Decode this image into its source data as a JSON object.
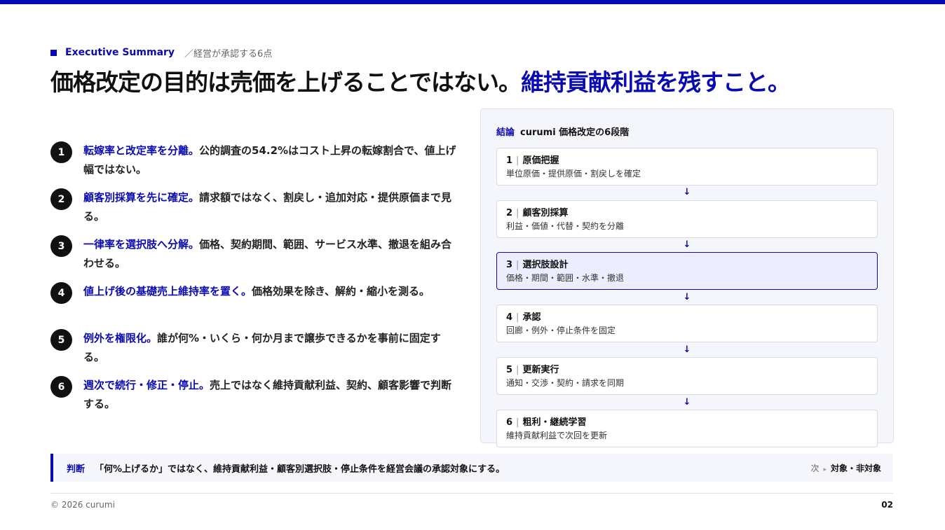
{
  "header": {
    "eyebrow_label": "Executive Summary",
    "eyebrow_sub": "／経営が承認する6点",
    "headline_main": "価格改定の目的は売価を上げることではない。",
    "headline_accent": "維持貢献利益を残すこと。"
  },
  "points": [
    {
      "num": "1",
      "lead": "転嫁率と改定率を分離。",
      "text": "公的調査の54.2%はコスト上昇の転嫁割合で、値上げ幅ではない。"
    },
    {
      "num": "2",
      "lead": "顧客別採算を先に確定。",
      "text": "請求額ではなく、割戻し・追加対応・提供原価まで見る。"
    },
    {
      "num": "3",
      "lead": "一律率を選択肢へ分解。",
      "text": "価格、契約期間、範囲、サービス水準、撤退を組み合わせる。"
    },
    {
      "num": "4",
      "lead": "値上げ後の基礎売上維持率を置く。",
      "text": "価格効果を除き、解約・縮小を測る。"
    },
    {
      "num": "5",
      "lead": "例外を権限化。",
      "text": "誰が何%・いくら・何か月まで譲歩できるかを事前に固定する。"
    },
    {
      "num": "6",
      "lead": "週次で続行・修正・停止。",
      "text": "売上ではなく維持貢献利益、契約、顧客影響で判断する。"
    }
  ],
  "panel": {
    "tag": "結論",
    "title": "curumi 価格改定の6段階",
    "arrow": "↓",
    "steps": [
      {
        "num": "1",
        "sep": "|",
        "title": "原価把握",
        "desc": "単位原価・提供原価・割戻しを確定"
      },
      {
        "num": "2",
        "sep": "|",
        "title": "顧客別採算",
        "desc": "利益・価値・代替・契約を分離"
      },
      {
        "num": "3",
        "sep": "|",
        "title": "選択肢設計",
        "desc": "価格・期間・範囲・水準・撤退"
      },
      {
        "num": "4",
        "sep": "|",
        "title": "承認",
        "desc": "回廊・例外・停止条件を固定"
      },
      {
        "num": "5",
        "sep": "|",
        "title": "更新実行",
        "desc": "通知・交渉・契約・請求を同期"
      },
      {
        "num": "6",
        "sep": "|",
        "title": "粗利・継続学習",
        "desc": "維持貢献利益で次回を更新"
      }
    ]
  },
  "decision": {
    "tag": "判断",
    "text": "「何%上げるか」ではなく、維持貢献利益・顧客別選択肢・停止条件を経営会議の承認対象にする。",
    "next_label": "次",
    "next_marker": "▸",
    "next_target": "対象・非対象"
  },
  "footer": {
    "copyright": "© 2026 curumi",
    "page": "02"
  },
  "colors": {
    "accent": "#0a0ab4",
    "text": "#111111",
    "panel_bg": "#f5f6fb"
  }
}
